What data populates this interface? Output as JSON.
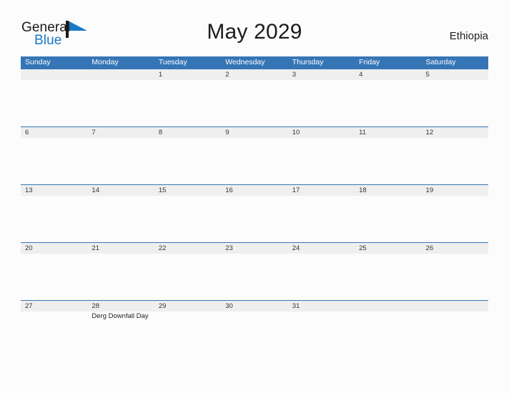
{
  "brand": {
    "name_part1": "General",
    "name_part2": "Blue",
    "logo_icon": "blue-flag-triangle-icon",
    "accent_color": "#1878c8"
  },
  "header": {
    "title": "May 2029",
    "region": "Ethiopia"
  },
  "theme": {
    "header_bar_color": "#3575b6",
    "date_band_color": "#efefef",
    "page_background": "#fcfcfc",
    "text_color": "#333333"
  },
  "calendar": {
    "month": "May",
    "year": "2029",
    "weekday_headers": [
      "Sunday",
      "Monday",
      "Tuesday",
      "Wednesday",
      "Thursday",
      "Friday",
      "Saturday"
    ],
    "weeks": [
      {
        "days": [
          {
            "num": "",
            "event": ""
          },
          {
            "num": "",
            "event": ""
          },
          {
            "num": "1",
            "event": ""
          },
          {
            "num": "2",
            "event": ""
          },
          {
            "num": "3",
            "event": ""
          },
          {
            "num": "4",
            "event": ""
          },
          {
            "num": "5",
            "event": ""
          }
        ]
      },
      {
        "days": [
          {
            "num": "6",
            "event": ""
          },
          {
            "num": "7",
            "event": ""
          },
          {
            "num": "8",
            "event": ""
          },
          {
            "num": "9",
            "event": ""
          },
          {
            "num": "10",
            "event": ""
          },
          {
            "num": "11",
            "event": ""
          },
          {
            "num": "12",
            "event": ""
          }
        ]
      },
      {
        "days": [
          {
            "num": "13",
            "event": ""
          },
          {
            "num": "14",
            "event": ""
          },
          {
            "num": "15",
            "event": ""
          },
          {
            "num": "16",
            "event": ""
          },
          {
            "num": "17",
            "event": ""
          },
          {
            "num": "18",
            "event": ""
          },
          {
            "num": "19",
            "event": ""
          }
        ]
      },
      {
        "days": [
          {
            "num": "20",
            "event": ""
          },
          {
            "num": "21",
            "event": ""
          },
          {
            "num": "22",
            "event": ""
          },
          {
            "num": "23",
            "event": ""
          },
          {
            "num": "24",
            "event": ""
          },
          {
            "num": "25",
            "event": ""
          },
          {
            "num": "26",
            "event": ""
          }
        ]
      },
      {
        "days": [
          {
            "num": "27",
            "event": ""
          },
          {
            "num": "28",
            "event": "Derg Downfall Day"
          },
          {
            "num": "29",
            "event": ""
          },
          {
            "num": "30",
            "event": ""
          },
          {
            "num": "31",
            "event": ""
          },
          {
            "num": "",
            "event": ""
          },
          {
            "num": "",
            "event": ""
          }
        ]
      }
    ]
  }
}
